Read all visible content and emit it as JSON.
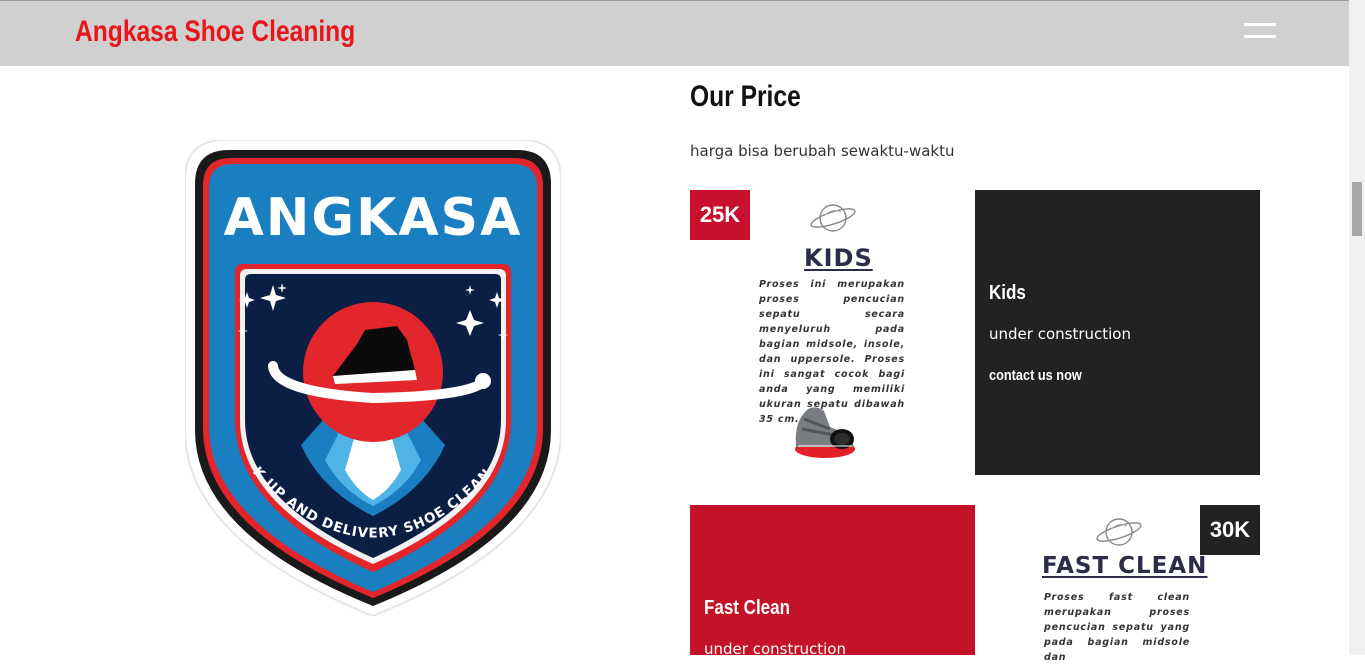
{
  "navbar": {
    "brand": "Angkasa Shoe Cleaning",
    "menu_icon": "hamburger-menu-icon"
  },
  "logo": {
    "wordmark": "ANGKASA",
    "tagline": "PICK UP AND DELIVERY SHOE CLEANING",
    "colors": {
      "blue": "#1a7fc1",
      "navy": "#0b1f45",
      "red": "#e3262b",
      "black": "#1a1a1a"
    }
  },
  "pricing": {
    "title": "Our Price",
    "subtitle": "harga bisa berubah sewaktu-waktu",
    "cards": [
      {
        "price": "25K",
        "heading": "KIDS",
        "description": "Proses ini merupakan proses pencucian sepatu secara menyeluruh pada bagian midsole, insole, dan uppersole. Proses ini sangat cocok bagi anda yang memiliki ukuran sepatu dibawah 35 cm.",
        "info_title": "Kids",
        "info_text": "under construction",
        "info_link": "contact us now"
      },
      {
        "price": "30K",
        "heading": "FAST CLEAN",
        "description": "Proses fast clean merupakan proses pencucian sepatu yang pada bagian midsole dan",
        "info_title": "Fast Clean",
        "info_text": "under construction"
      }
    ]
  },
  "colors": {
    "accent_red": "#c8102e",
    "brand_red": "#e8151b",
    "dark": "#222222",
    "navbar_bg": "#d0d0d0"
  }
}
